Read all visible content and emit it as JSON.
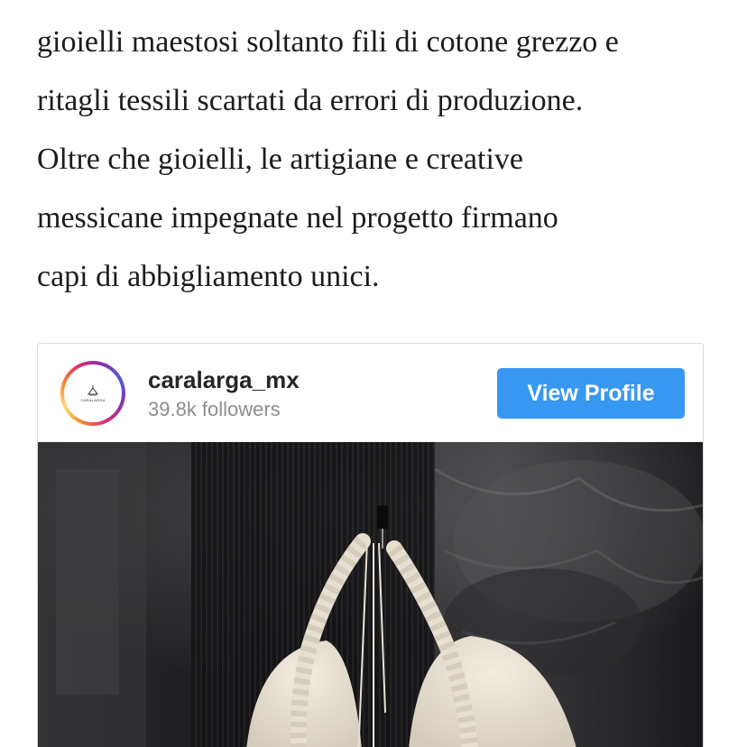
{
  "article": {
    "lines": [
      "gioielli maestosi soltanto fili di cotone grezzo e",
      "ritagli tessili scartati da errori di produzione.",
      "Oltre che gioielli, le artigiane e creative",
      "messicane impegnate nel progetto firmano",
      "capi di abbigliamento unici."
    ]
  },
  "embed": {
    "username": "caralarga_mx",
    "followers": "39.8k followers",
    "view_profile_label": "View Profile",
    "avatar_brand": "CARALARGA",
    "accent_color": "#3897f0"
  }
}
